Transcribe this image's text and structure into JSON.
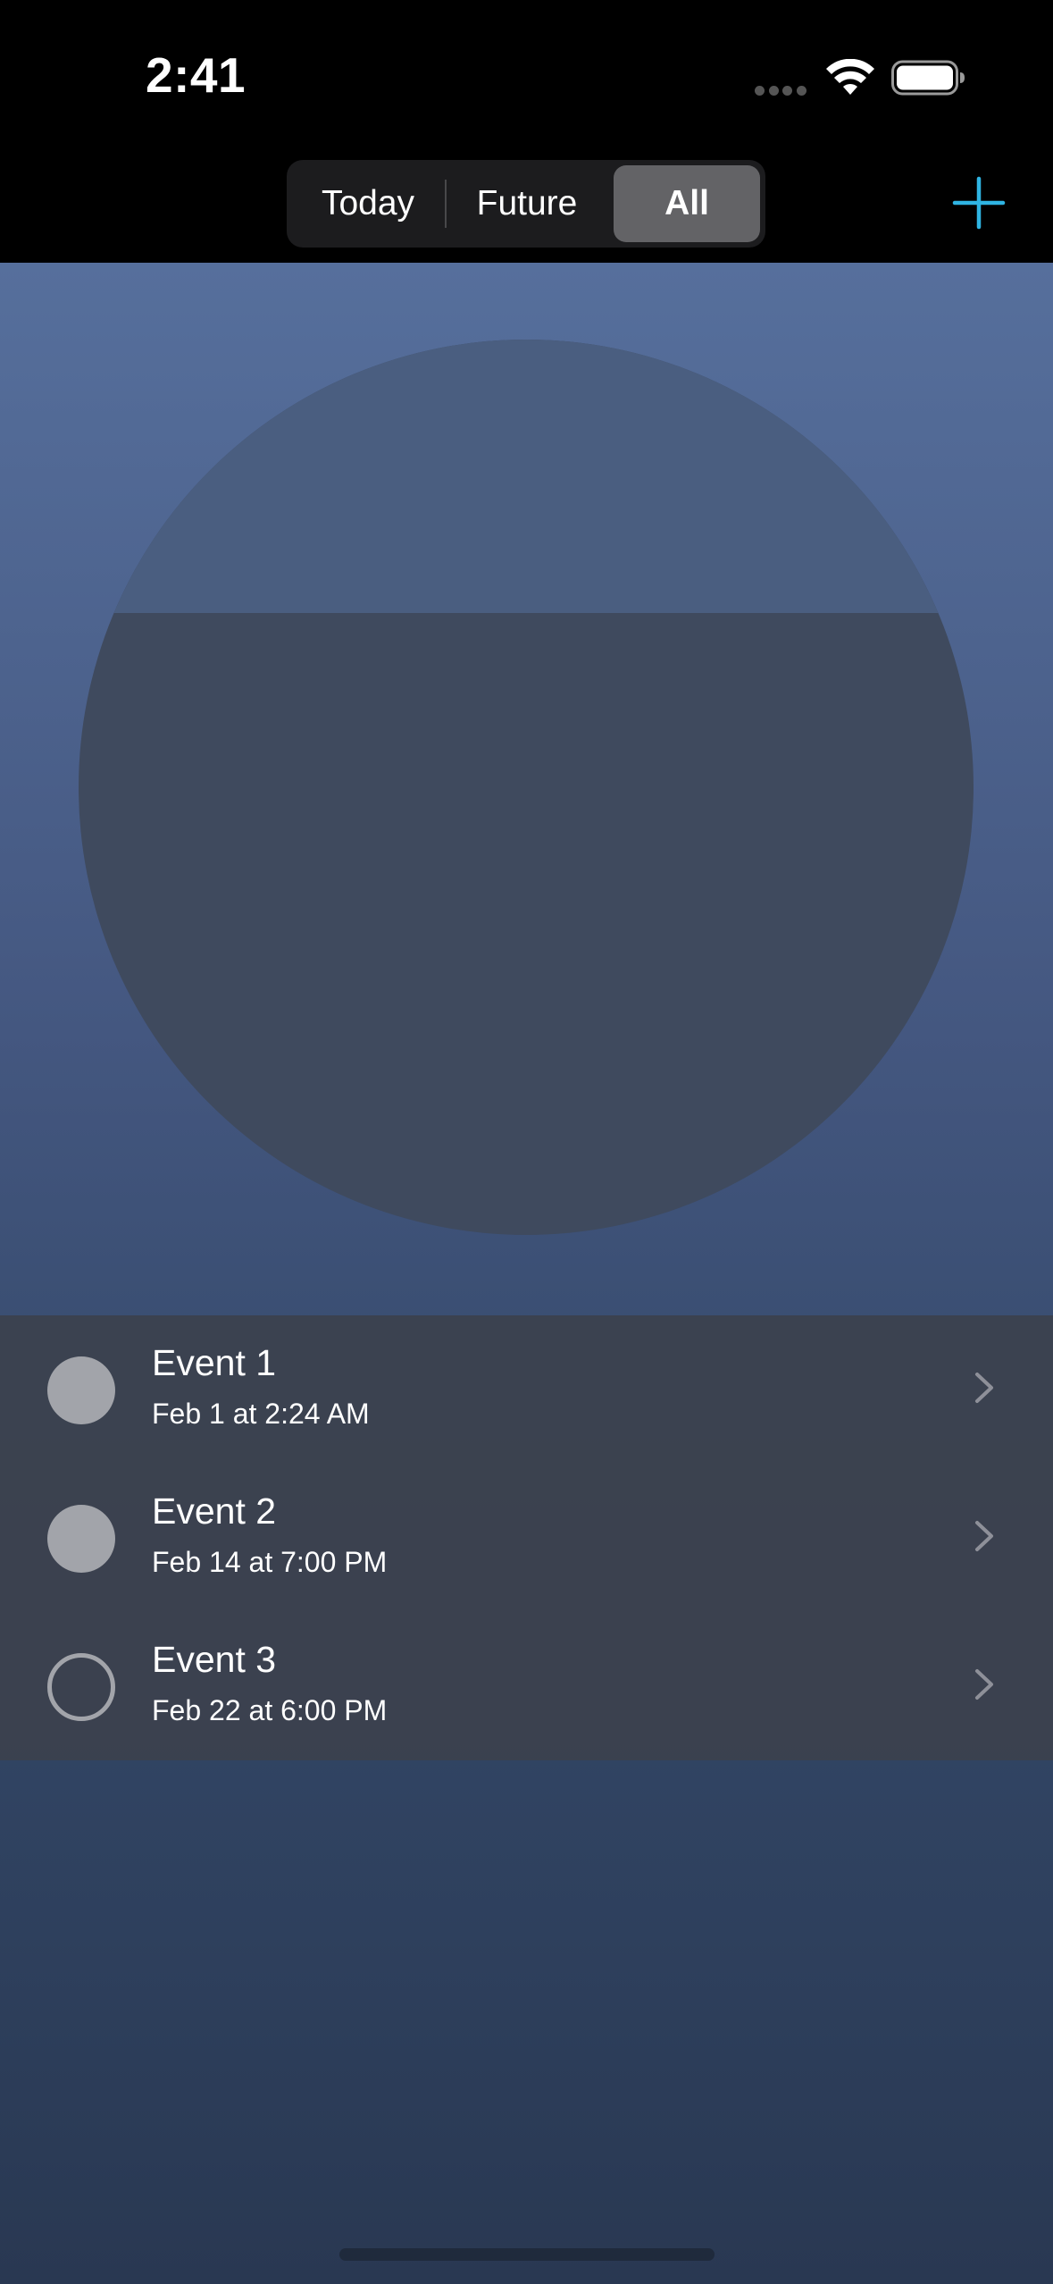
{
  "status_bar": {
    "time": "2:41",
    "icons": [
      "cellular-dots-icon",
      "wifi-icon",
      "battery-icon"
    ]
  },
  "nav": {
    "segments": [
      {
        "label": "Today",
        "selected": false
      },
      {
        "label": "Future",
        "selected": false
      },
      {
        "label": "All",
        "selected": true
      }
    ],
    "add_icon": "plus-icon",
    "accent_color": "#2fb4e3"
  },
  "progress": {
    "filled_fraction": 0.695,
    "fill_color": "#3f4a5e",
    "track_color": "#4a5e80"
  },
  "events": [
    {
      "title": "Event 1",
      "date": "Feb 1 at 2:24 AM",
      "status": "filled",
      "icon": "chevron-right-icon"
    },
    {
      "title": "Event 2",
      "date": "Feb 14 at 7:00 PM",
      "status": "filled",
      "icon": "chevron-right-icon"
    },
    {
      "title": "Event 3",
      "date": "Feb 22 at 6:00 PM",
      "status": "empty",
      "icon": "chevron-right-icon"
    }
  ],
  "colors": {
    "gradient_top": "#566f9c",
    "gradient_bottom": "#293852",
    "list_background": "#3c414d"
  }
}
